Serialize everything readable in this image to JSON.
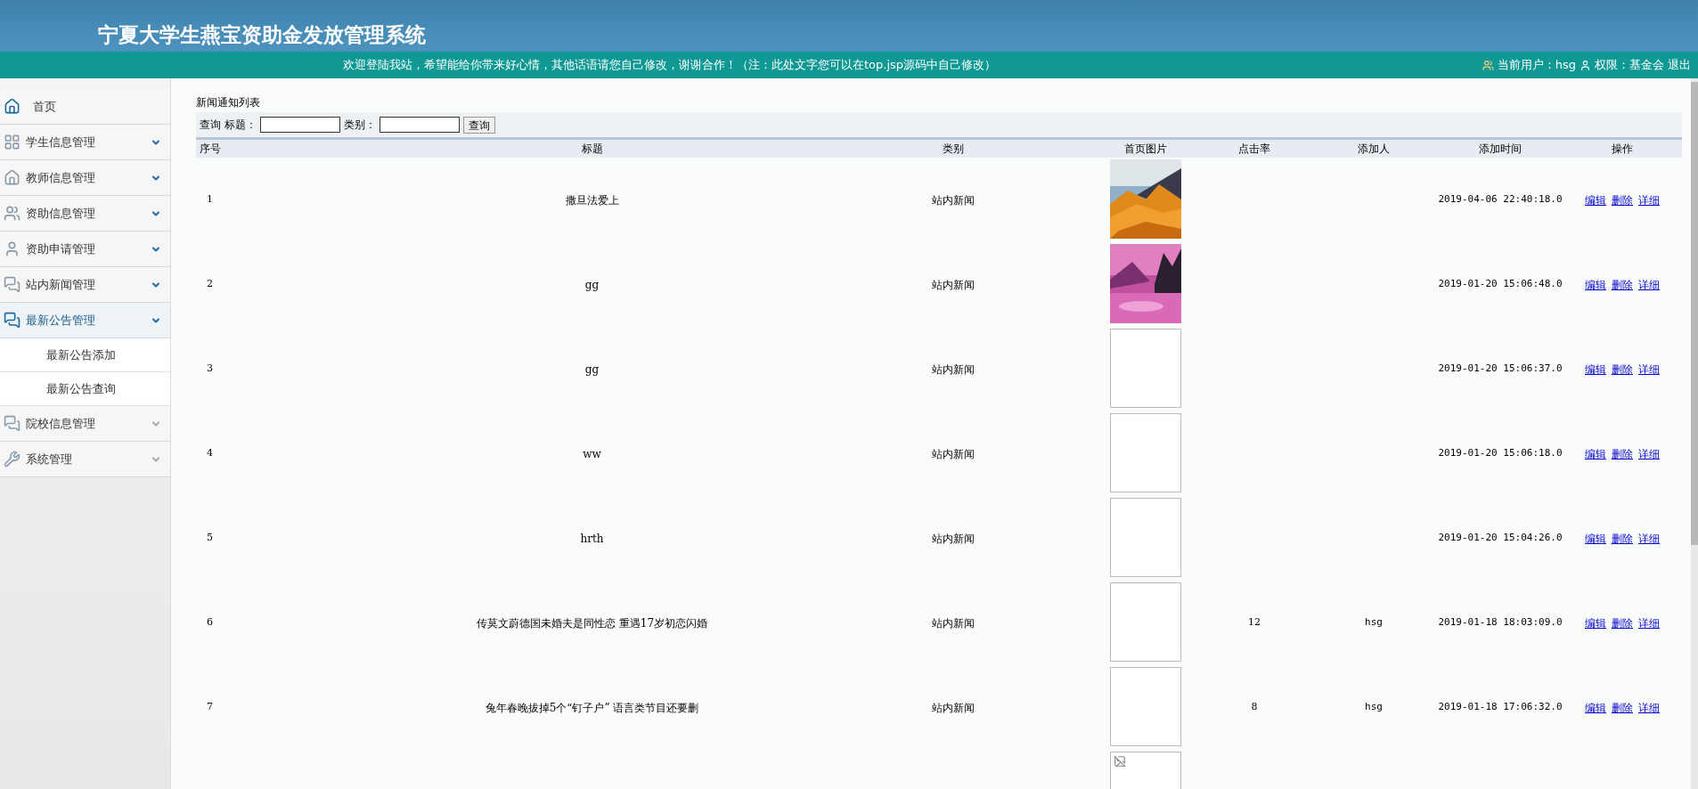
{
  "header": {
    "title": "宁夏大学生燕宝资助金发放管理系统"
  },
  "notice_bar": {
    "message": "欢迎登陆我站，希望能给你带来好心情，其他话语请您自己修改，谢谢合作！（注：此处文字您可以在top.jsp源码中自己修改）",
    "user_label": "当前用户：hsg",
    "role_label": "权限：基金会",
    "logout": "退出"
  },
  "sidebar": {
    "items": [
      {
        "label": "首页",
        "expanded": false
      },
      {
        "label": "学生信息管理",
        "expanded": false
      },
      {
        "label": "教师信息管理",
        "expanded": false
      },
      {
        "label": "资助信息管理",
        "expanded": false
      },
      {
        "label": "资助申请管理",
        "expanded": false
      },
      {
        "label": "站内新闻管理",
        "expanded": false
      },
      {
        "label": "最新公告管理",
        "expanded": true,
        "children": [
          {
            "label": "最新公告添加"
          },
          {
            "label": "最新公告查询"
          }
        ]
      },
      {
        "label": "院校信息管理",
        "expanded": false
      },
      {
        "label": "系统管理",
        "expanded": false
      }
    ]
  },
  "content": {
    "title": "新闻通知列表",
    "search": {
      "label": "查询",
      "fields": [
        {
          "label": "标题："
        },
        {
          "label": "类别："
        }
      ],
      "button": "查询"
    },
    "table": {
      "columns": [
        "序号",
        "标题",
        "类别",
        "首页图片",
        "点击率",
        "添加人",
        "添加时间",
        "操作"
      ],
      "rows": [
        {
          "kind": "picture",
          "no": "1",
          "title": "撒旦法爱上",
          "category": "站内新闻",
          "time": "2019-04-06 22:40:18.0",
          "actions": [
            "编辑",
            "删除",
            "详细"
          ]
        },
        {
          "kind": "picture",
          "no": "2",
          "title": "gg",
          "category": "站内新闻",
          "time": "2019-01-20 15:06:48.0",
          "actions": [
            "编辑",
            "删除",
            "详细"
          ]
        },
        {
          "kind": "empty",
          "no": "3",
          "title": "gg",
          "category": "站内新闻",
          "time": "2019-01-20 15:06:37.0",
          "actions": [
            "编辑",
            "删除",
            "详细"
          ]
        },
        {
          "kind": "empty",
          "no": "4",
          "title": "ww",
          "category": "站内新闻",
          "time": "2019-01-20 15:06:18.0",
          "actions": [
            "编辑",
            "删除",
            "详细"
          ]
        },
        {
          "kind": "empty",
          "no": "5",
          "title": "hrth",
          "category": "站内新闻",
          "time": "2019-01-20 15:04:26.0",
          "actions": [
            "编辑",
            "删除",
            "详细"
          ]
        },
        {
          "kind": "empty",
          "no": "6",
          "title": "传莫文蔚德国未婚夫是同性恋 重遇17岁初恋闪婚",
          "category": "站内新闻",
          "clicks": "12",
          "author": "hsg",
          "time": "2019-01-18 18:03:09.0",
          "actions": [
            "编辑",
            "删除",
            "详细"
          ]
        },
        {
          "kind": "empty",
          "no": "7",
          "title": "兔年春晚拔掉5个“钉子户” 语言类节目还要删",
          "category": "站内新闻",
          "clicks": "8",
          "author": "hsg",
          "time": "2019-01-18 17:06:32.0",
          "actions": [
            "编辑",
            "删除",
            "详细"
          ]
        },
        {
          "kind": "broken"
        }
      ]
    }
  }
}
